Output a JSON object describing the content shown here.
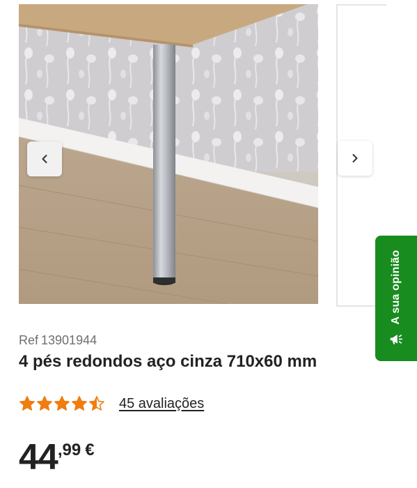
{
  "gallery": {
    "photo_alt": "4 pés redondos aço cinza 710x60 mm",
    "prev_icon": "chevron-left-icon",
    "next_icon": "chevron-right-icon"
  },
  "feedback": {
    "label": "A sua opinião",
    "icon": "megaphone-icon",
    "color": "#188c1e"
  },
  "product": {
    "ref_label": "Ref",
    "ref_number": "13901944",
    "title": "4 pés redondos aço cinza 710x60 mm",
    "rating": {
      "value": 4.5,
      "max": 5,
      "star_color": "#ef7d10",
      "reviews_text": "45 avaliações"
    },
    "price": {
      "integer": "44",
      "decimal": ",99",
      "currency": "€"
    }
  }
}
